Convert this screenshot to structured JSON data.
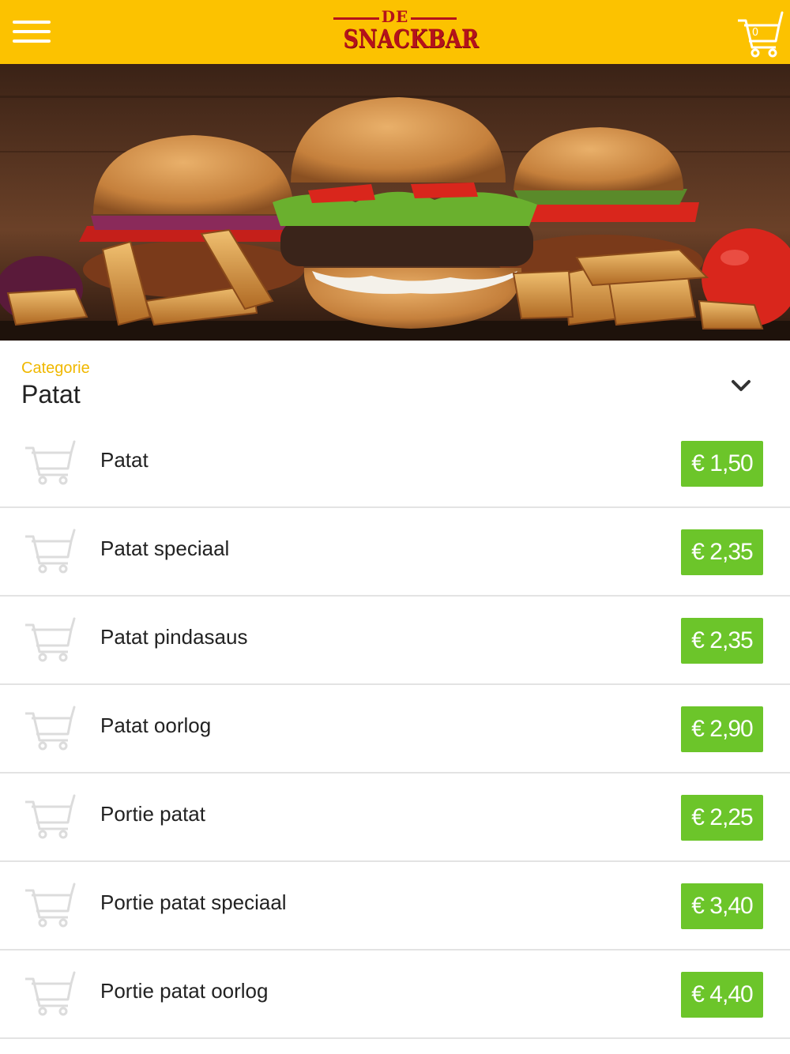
{
  "header": {
    "logo_top": "DE",
    "logo_main": "SNACKBAR",
    "cart_count": "0"
  },
  "colors": {
    "header_bg": "#fcc200",
    "logo_red": "#b5121b",
    "category_label": "#f0b800",
    "price_bg": "#6cc52a"
  },
  "category": {
    "label": "Categorie",
    "value": "Patat"
  },
  "items": [
    {
      "name": "Patat",
      "price": "€ 1,50"
    },
    {
      "name": "Patat speciaal",
      "price": "€ 2,35"
    },
    {
      "name": "Patat pindasaus",
      "price": "€ 2,35"
    },
    {
      "name": "Patat oorlog",
      "price": "€ 2,90"
    },
    {
      "name": "Portie patat",
      "price": "€ 2,25"
    },
    {
      "name": "Portie patat speciaal",
      "price": "€ 3,40"
    },
    {
      "name": "Portie patat oorlog",
      "price": "€ 4,40"
    }
  ]
}
